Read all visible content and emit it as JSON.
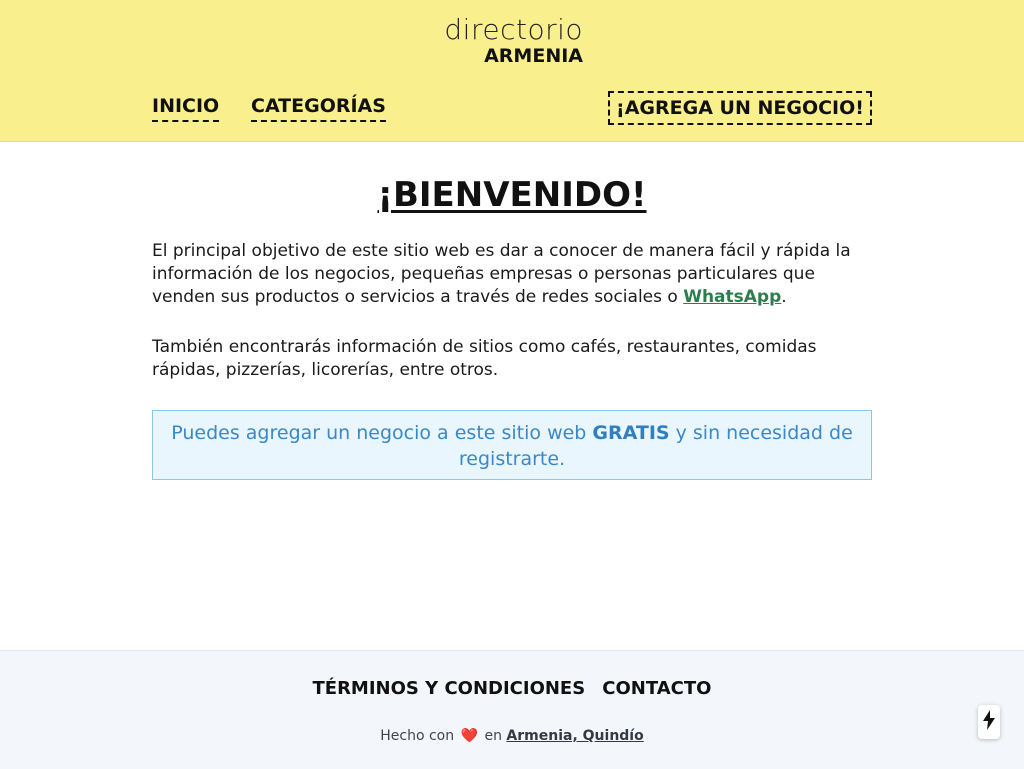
{
  "header": {
    "logo_top": "directorio",
    "logo_bottom": "ARMENIA",
    "background_color": "#f9ef8c"
  },
  "nav": {
    "items": [
      {
        "label": "INICIO"
      },
      {
        "label": "CATEGORÍAS"
      }
    ],
    "cta_label": "¡AGREGA UN NEGOCIO!"
  },
  "main": {
    "title": "¡BIENVENIDO!",
    "paragraph1_before": "El principal objetivo de este sitio web es dar a conocer de manera fácil y rápida la información de los negocios, pequeñas empresas o personas particulares que venden sus productos o servicios a través de redes sociales o ",
    "paragraph1_link": "WhatsApp",
    "paragraph1_after": ".",
    "paragraph2": "También encontrarás información de sitios como cafés, restaurantes, comidas rápidas, pizzerías, licorerías, entre otros.",
    "notice_before": "Puedes agregar un negocio a este sitio web ",
    "notice_bold": "GRATIS",
    "notice_after": " y sin necesidad de registrarte."
  },
  "footer": {
    "links": [
      {
        "label": "TÉRMINOS Y CONDICIONES"
      },
      {
        "label": "CONTACTO"
      }
    ],
    "credit_before": "Hecho con",
    "credit_heart_icon": "heart-icon",
    "credit_middle": "en",
    "credit_location": "Armenia, Quindío"
  },
  "floating_button": {
    "icon": "lightning-bolt-icon"
  },
  "colors": {
    "whatsapp_link": "#2e7d4f",
    "notice_text": "#3a88c7",
    "notice_background": "#eaf6fd",
    "footer_background": "#f3f7fb"
  }
}
